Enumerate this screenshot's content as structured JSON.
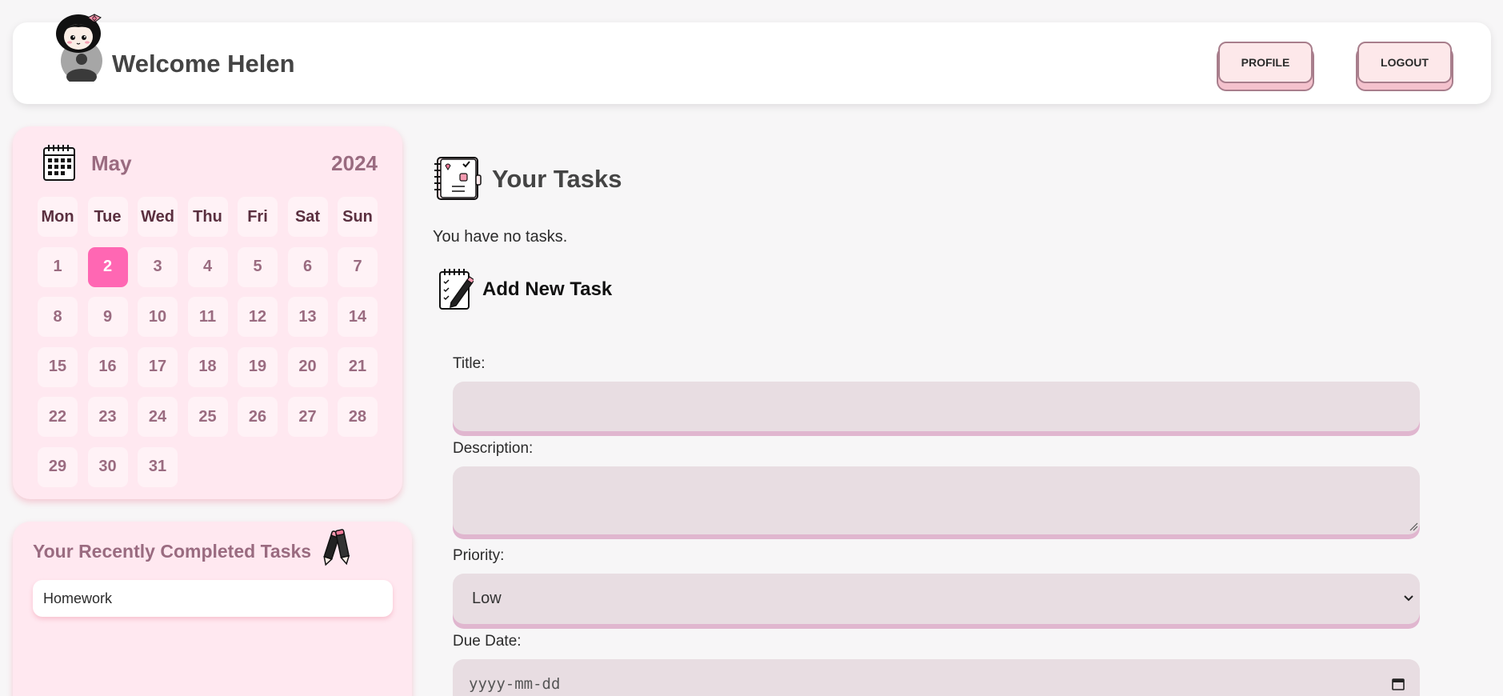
{
  "header": {
    "welcome": "Welcome Helen",
    "profile_label": "PROFILE",
    "logout_label": "LOGOUT"
  },
  "calendar": {
    "month": "May",
    "year": "2024",
    "weekdays": [
      "Mon",
      "Tue",
      "Wed",
      "Thu",
      "Fri",
      "Sat",
      "Sun"
    ],
    "days": [
      "1",
      "2",
      "3",
      "4",
      "5",
      "6",
      "7",
      "8",
      "9",
      "10",
      "11",
      "12",
      "13",
      "14",
      "15",
      "16",
      "17",
      "18",
      "19",
      "20",
      "21",
      "22",
      "23",
      "24",
      "25",
      "26",
      "27",
      "28",
      "29",
      "30",
      "31"
    ],
    "today": "2",
    "accent_color": "#ff67b3"
  },
  "completed": {
    "title": "Your Recently Completed Tasks",
    "items": [
      "Homework"
    ]
  },
  "tasks": {
    "title": "Your Tasks",
    "empty_message": "You have no tasks."
  },
  "add_task": {
    "title": "Add New Task",
    "title_label": "Title:",
    "title_value": "",
    "description_label": "Description:",
    "description_value": "",
    "priority_label": "Priority:",
    "priority_value": "Low",
    "due_date_label": "Due Date:",
    "due_date_placeholder": "yyyy-mm-dd"
  },
  "icons": {
    "avatar": "avatar-girl-icon",
    "calendar": "calendar-icon",
    "tasks": "notebook-icon",
    "add": "notepad-pencil-icon",
    "completed": "pencils-icon"
  }
}
